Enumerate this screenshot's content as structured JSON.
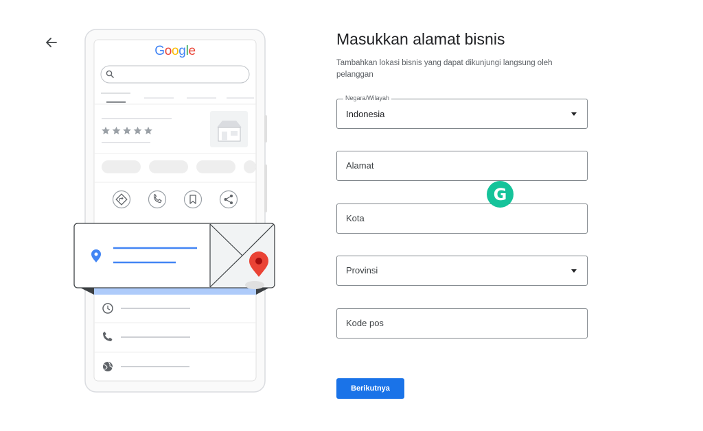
{
  "nav": {
    "back_icon": "arrow-left-icon"
  },
  "illustration": {
    "logo_letters": [
      {
        "char": "G",
        "color": "#4285F4"
      },
      {
        "char": "o",
        "color": "#EA4335"
      },
      {
        "char": "o",
        "color": "#FBBC05"
      },
      {
        "char": "g",
        "color": "#4285F4"
      },
      {
        "char": "l",
        "color": "#34A853"
      },
      {
        "char": "e",
        "color": "#EA4335"
      }
    ],
    "rating_stars": 5,
    "action_icons": [
      "directions-icon",
      "phone-icon",
      "bookmark-icon",
      "share-icon"
    ],
    "info_icons": [
      "clock-icon",
      "phone-icon",
      "globe-icon"
    ],
    "accent_blue": "#4285F4",
    "pin_red": "#EA4335"
  },
  "form": {
    "title": "Masukkan alamat bisnis",
    "subtitle": "Tambahkan lokasi bisnis yang dapat dikunjungi langsung oleh pelanggan",
    "country": {
      "label": "Negara/Wilayah",
      "value": "Indonesia"
    },
    "address": {
      "placeholder": "Alamat"
    },
    "city": {
      "placeholder": "Kota"
    },
    "province": {
      "placeholder": "Provinsi"
    },
    "postal": {
      "placeholder": "Kode pos"
    },
    "next_label": "Berikutnya",
    "primary_color": "#1a73e8"
  },
  "extension": {
    "grammarly_letter": "G",
    "color": "#15c39a"
  }
}
